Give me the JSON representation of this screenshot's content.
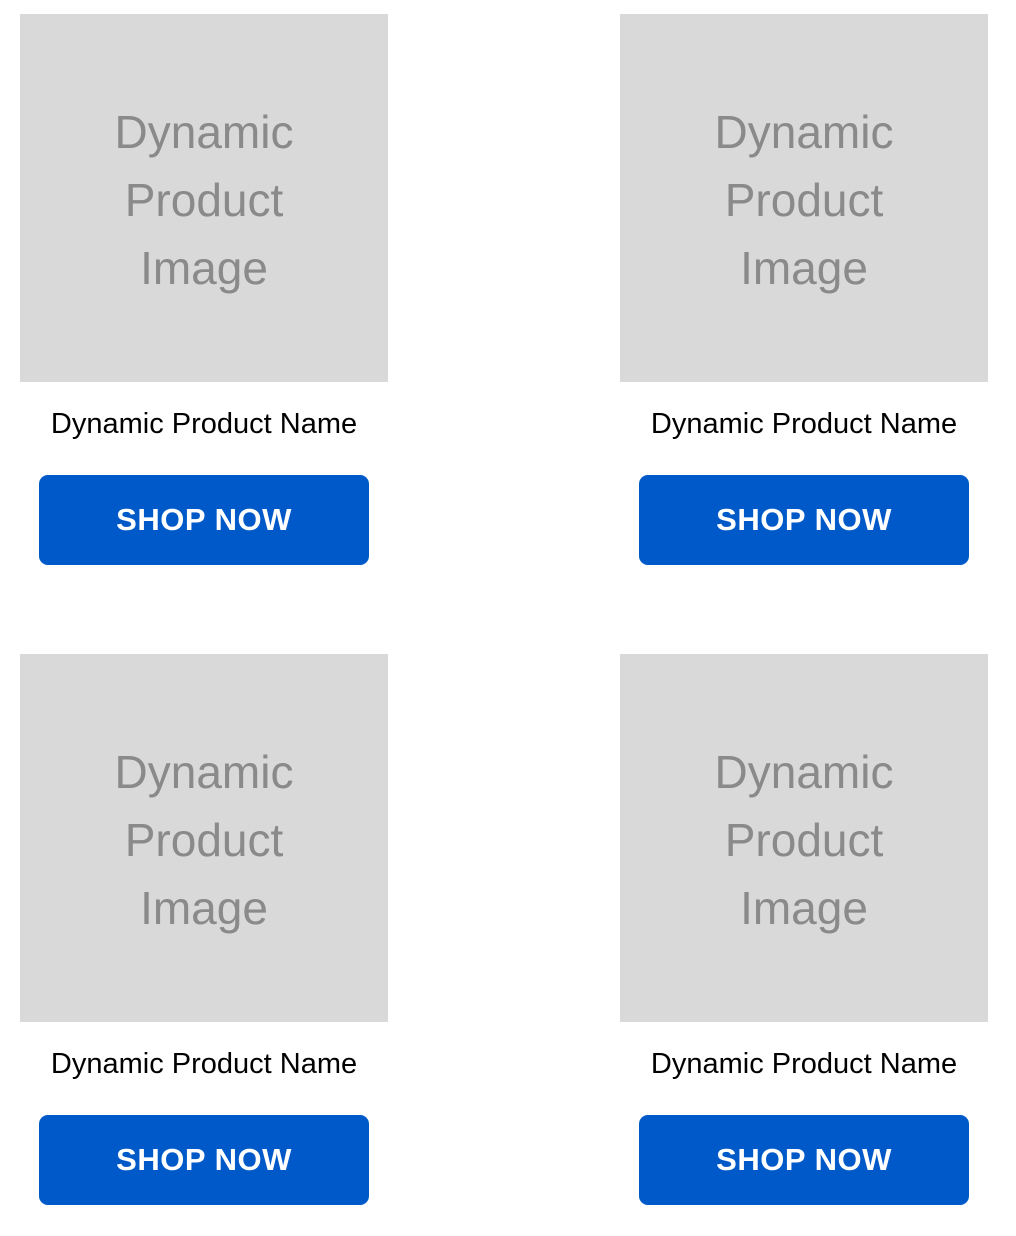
{
  "products": [
    {
      "image_placeholder": "Dynamic Product Image",
      "name": "Dynamic Product Name",
      "button_label": "SHOP NOW"
    },
    {
      "image_placeholder": "Dynamic Product Image",
      "name": "Dynamic Product Name",
      "button_label": "SHOP NOW"
    },
    {
      "image_placeholder": "Dynamic Product Image",
      "name": "Dynamic Product Name",
      "button_label": "SHOP NOW"
    },
    {
      "image_placeholder": "Dynamic Product Image",
      "name": "Dynamic Product Name",
      "button_label": "SHOP NOW"
    }
  ],
  "colors": {
    "button_background": "#0059c9",
    "button_text": "#ffffff",
    "image_placeholder_background": "#d9d9d9",
    "image_placeholder_text": "#8a8a8a",
    "product_name_text": "#000000"
  }
}
